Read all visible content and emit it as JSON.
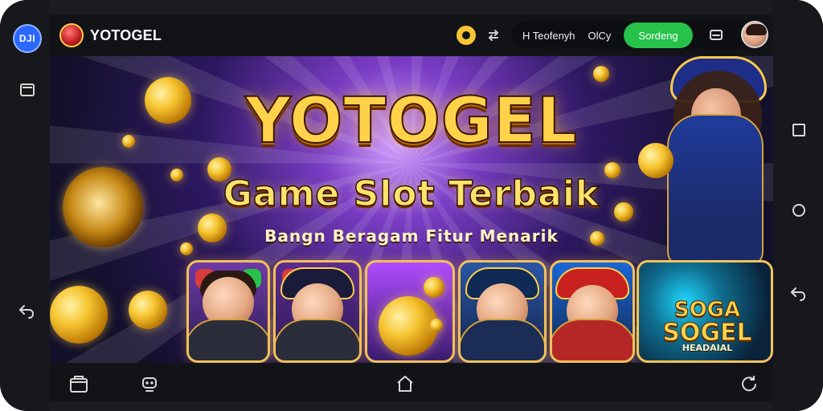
{
  "topbar": {
    "logo_text": "YOTOGEL",
    "left_logo_text": "DJI",
    "menu_item_1": "H Teofenyh",
    "menu_item_2": "OlCy",
    "primary_button": "Sordeng"
  },
  "banner": {
    "headline": "YOTOGEL",
    "subheadline": "Game Slot Terbaik",
    "tagline": "Bangn Beragam Fitur Menarik"
  },
  "cards": {
    "promo_title_1": "SOGA",
    "promo_title_2": "SOGEL",
    "promo_subtitle": "HEADAIAL"
  },
  "bottom_nav": {
    "center_home_label": "",
    "left_tab_label": "",
    "right_tab_label": ""
  },
  "icons": {
    "left_app_icon": "app-logo-icon",
    "topbar_avatar": "avatar-icon",
    "topbar_settings": "gear-icon",
    "topbar_swap": "swap-icon",
    "topbar_chat": "chat-icon",
    "left_menu": "menu-icon",
    "left_back": "back-icon",
    "right_square": "square-icon",
    "right_circle": "circle-icon",
    "right_back": "back-icon",
    "bottom_shop": "shop-icon",
    "bottom_robot": "robot-icon",
    "bottom_home": "home-icon",
    "bottom_refresh": "refresh-icon"
  },
  "colors": {
    "accent_green": "#27c24a",
    "gold": "#ffd24a",
    "dark_bg": "#121317"
  }
}
